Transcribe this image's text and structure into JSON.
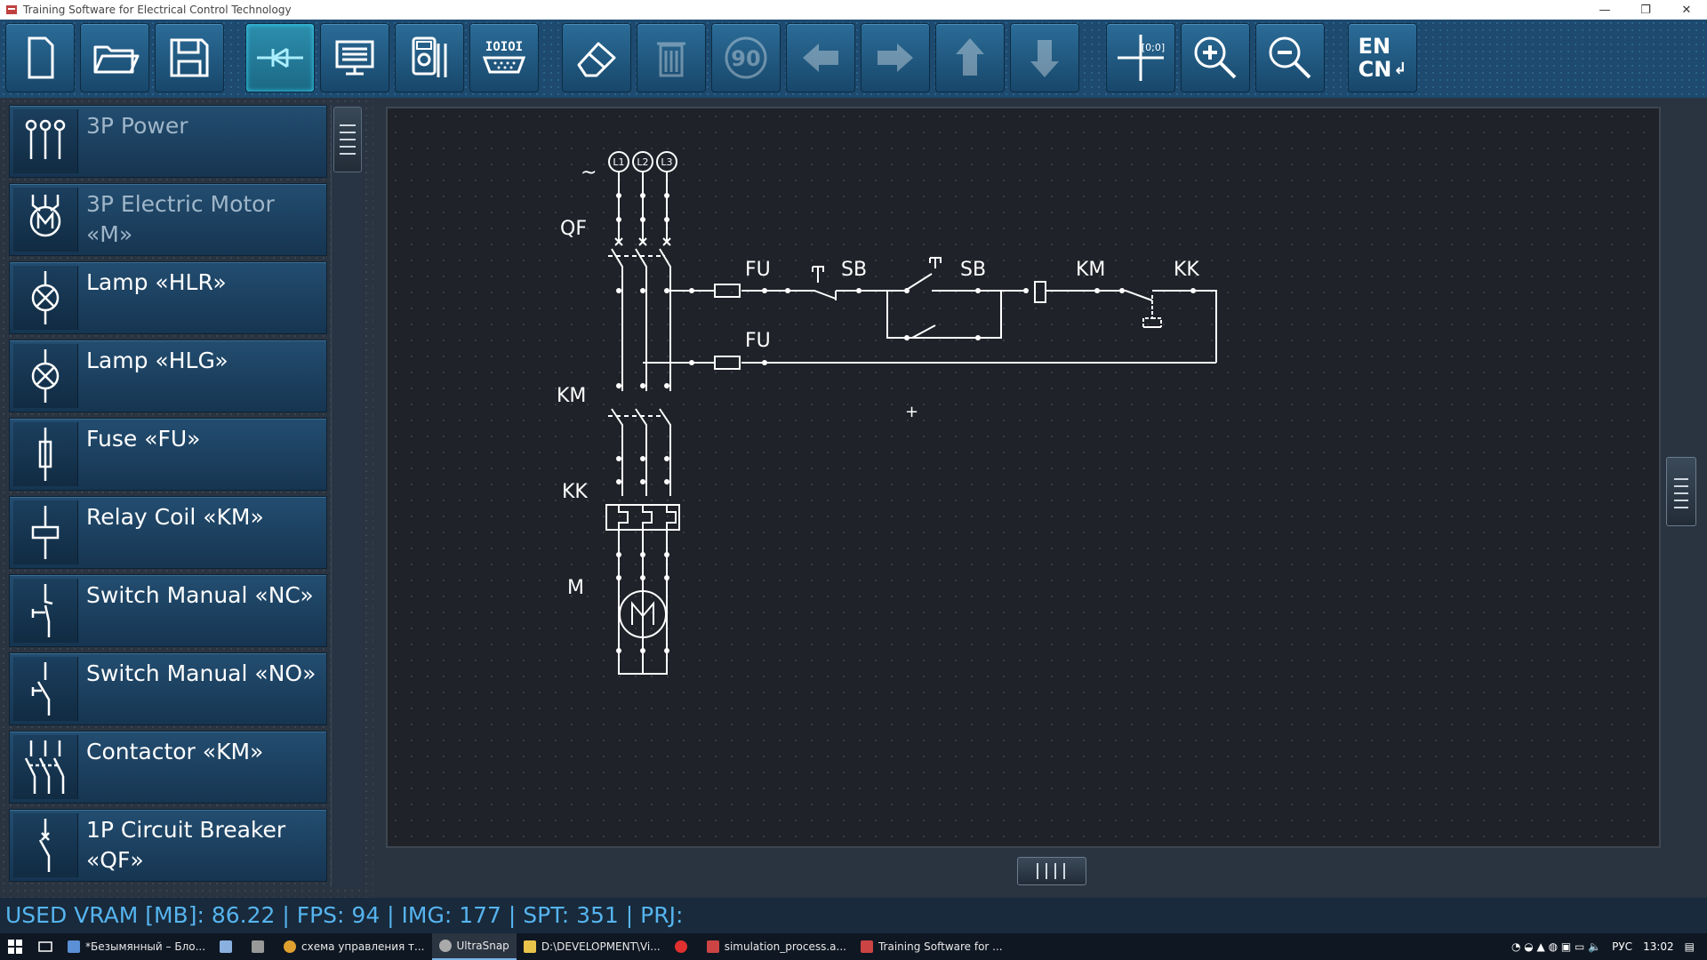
{
  "window": {
    "title": "Training Software for Electrical Control Technology",
    "min_glyph": "—",
    "max_glyph": "❐",
    "close_glyph": "✕"
  },
  "toolbar": {
    "buttons": [
      {
        "name": "new-file-button",
        "icon": "file-icon"
      },
      {
        "name": "open-folder-button",
        "icon": "folder-icon"
      },
      {
        "name": "save-button",
        "icon": "floppy-icon"
      },
      {
        "name": "wire-mode-button",
        "icon": "wire-icon",
        "active": true
      },
      {
        "name": "simulation-button",
        "icon": "monitor-icon"
      },
      {
        "name": "multimeter-button",
        "icon": "multimeter-icon"
      },
      {
        "name": "serial-port-button",
        "icon": "serial-port-icon",
        "text": "IOIOI"
      },
      {
        "name": "eraser-button",
        "icon": "eraser-icon"
      },
      {
        "name": "delete-button",
        "icon": "trash-icon",
        "disabled": true
      },
      {
        "name": "rotate-button",
        "icon": "rotate-90-icon",
        "text": "90",
        "disabled": true
      },
      {
        "name": "move-left-button",
        "icon": "arrow-left-icon",
        "disabled": true
      },
      {
        "name": "move-right-button",
        "icon": "arrow-right-icon",
        "disabled": true
      },
      {
        "name": "move-up-button",
        "icon": "arrow-up-icon",
        "disabled": true
      },
      {
        "name": "move-down-button",
        "icon": "arrow-down-icon",
        "disabled": true
      },
      {
        "name": "origin-button",
        "icon": "crosshair-origin-icon",
        "text": "[0;0]"
      },
      {
        "name": "zoom-in-button",
        "icon": "zoom-in-icon"
      },
      {
        "name": "zoom-out-button",
        "icon": "zoom-out-icon"
      }
    ],
    "lang": {
      "line1": "EN",
      "line2": "CN",
      "glyph": "↲"
    }
  },
  "palette": {
    "items": [
      {
        "label": "3P Power",
        "icon": "three-phase-power-icon",
        "dim": true
      },
      {
        "label": "3P Electric Motor «M»",
        "icon": "motor-icon",
        "dim": true
      },
      {
        "label": "Lamp «HLR»",
        "icon": "lamp-icon"
      },
      {
        "label": "Lamp «HLG»",
        "icon": "lamp-icon"
      },
      {
        "label": "Fuse «FU»",
        "icon": "fuse-icon"
      },
      {
        "label": "Relay Coil «KM»",
        "icon": "relay-coil-icon"
      },
      {
        "label": "Switch Manual «NC»",
        "icon": "switch-nc-icon"
      },
      {
        "label": "Switch Manual «NO»",
        "icon": "switch-no-icon"
      },
      {
        "label": "Contactor «KM»",
        "icon": "contactor-icon"
      },
      {
        "label": "1P Circuit Breaker «QF»",
        "icon": "circuit-breaker-icon"
      }
    ]
  },
  "schematic": {
    "labels": {
      "ac": "~",
      "qf": "QF",
      "km_main": "KM",
      "kk_main": "KK",
      "m": "M",
      "fu1": "FU",
      "fu2": "FU",
      "sb1": "SB",
      "sb2": "SB",
      "km_coil": "KM",
      "kk_ctrl": "KK",
      "l1": "L1",
      "l2": "L2",
      "l3": "L3",
      "motor_letter": "M",
      "cursor": "+"
    }
  },
  "status": {
    "text": "USED VRAM [MB]: 86.22 | FPS: 94 | IMG: 177 | SPT: 351 | PRJ:"
  },
  "taskbar": {
    "items": [
      {
        "label": "*Безымянный – Бло...",
        "color": "#5b8fd6"
      },
      {
        "label": "",
        "color": "#8ab0e0"
      },
      {
        "label": "",
        "color": "#999999"
      },
      {
        "label": "схема управления т...",
        "color": "#e0a030"
      },
      {
        "label": "UltraSnap",
        "color": "#aaaaaa",
        "active": true
      },
      {
        "label": "D:\\DEVELOPMENT\\Vi...",
        "color": "#e8c44a"
      },
      {
        "label": "",
        "color": "#e03030"
      },
      {
        "label": "simulation_process.a...",
        "color": "#cc4444"
      },
      {
        "label": "Training Software for ...",
        "color": "#cc4444"
      }
    ],
    "tray": {
      "lang": "РУС",
      "time": "13:02"
    }
  }
}
